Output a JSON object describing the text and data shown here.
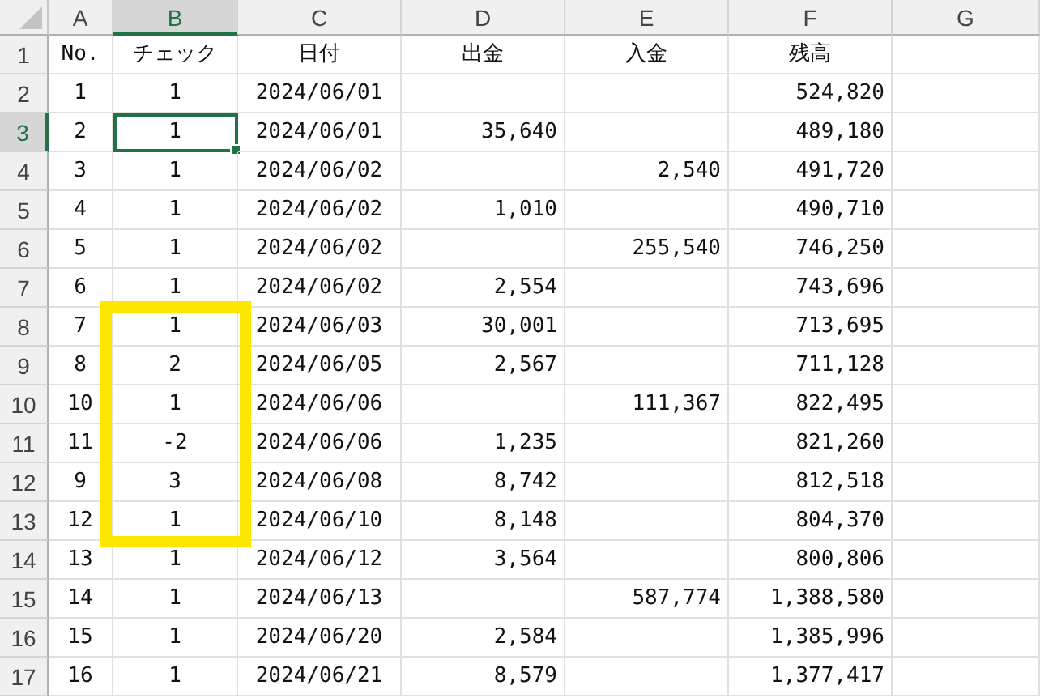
{
  "columns": [
    {
      "label": "A",
      "selected": false
    },
    {
      "label": "B",
      "selected": true
    },
    {
      "label": "C",
      "selected": false
    },
    {
      "label": "D",
      "selected": false
    },
    {
      "label": "E",
      "selected": false
    },
    {
      "label": "F",
      "selected": false
    },
    {
      "label": "G",
      "selected": false
    }
  ],
  "rows": [
    {
      "label": "1",
      "selected": false,
      "boxed": false,
      "cells": [
        "No.",
        "チェック",
        "日付",
        "出金",
        "入金",
        "残高",
        ""
      ]
    },
    {
      "label": "2",
      "selected": false,
      "boxed": false,
      "cells": [
        "1",
        "1",
        "2024/06/01",
        "",
        "",
        "524,820",
        ""
      ]
    },
    {
      "label": "3",
      "selected": true,
      "boxed": false,
      "cells": [
        "2",
        "1",
        "2024/06/01",
        "35,640",
        "",
        "489,180",
        ""
      ]
    },
    {
      "label": "4",
      "selected": false,
      "boxed": false,
      "cells": [
        "3",
        "1",
        "2024/06/02",
        "",
        "2,540",
        "491,720",
        ""
      ]
    },
    {
      "label": "5",
      "selected": false,
      "boxed": false,
      "cells": [
        "4",
        "1",
        "2024/06/02",
        "1,010",
        "",
        "490,710",
        ""
      ]
    },
    {
      "label": "6",
      "selected": false,
      "boxed": false,
      "cells": [
        "5",
        "1",
        "2024/06/02",
        "",
        "255,540",
        "746,250",
        ""
      ]
    },
    {
      "label": "7",
      "selected": false,
      "boxed": false,
      "cells": [
        "6",
        "1",
        "2024/06/02",
        "2,554",
        "",
        "743,696",
        ""
      ]
    },
    {
      "label": "8",
      "selected": false,
      "boxed": true,
      "cells": [
        "7",
        "1",
        "2024/06/03",
        "30,001",
        "",
        "713,695",
        ""
      ]
    },
    {
      "label": "9",
      "selected": false,
      "boxed": true,
      "cells": [
        "8",
        "2",
        "2024/06/05",
        "2,567",
        "",
        "711,128",
        ""
      ]
    },
    {
      "label": "10",
      "selected": false,
      "boxed": true,
      "cells": [
        "10",
        "1",
        "2024/06/06",
        "",
        "111,367",
        "822,495",
        ""
      ]
    },
    {
      "label": "11",
      "selected": false,
      "boxed": true,
      "cells": [
        "11",
        "-2",
        "2024/06/06",
        "1,235",
        "",
        "821,260",
        ""
      ]
    },
    {
      "label": "12",
      "selected": false,
      "boxed": true,
      "cells": [
        "9",
        "3",
        "2024/06/08",
        "8,742",
        "",
        "812,518",
        ""
      ]
    },
    {
      "label": "13",
      "selected": false,
      "boxed": true,
      "cells": [
        "12",
        "1",
        "2024/06/10",
        "8,148",
        "",
        "804,370",
        ""
      ]
    },
    {
      "label": "14",
      "selected": false,
      "boxed": false,
      "cells": [
        "13",
        "1",
        "2024/06/12",
        "3,564",
        "",
        "800,806",
        ""
      ]
    },
    {
      "label": "15",
      "selected": false,
      "boxed": false,
      "cells": [
        "14",
        "1",
        "2024/06/13",
        "",
        "587,774",
        "1,388,580",
        ""
      ]
    },
    {
      "label": "16",
      "selected": false,
      "boxed": false,
      "cells": [
        "15",
        "1",
        "2024/06/20",
        "2,584",
        "",
        "1,385,996",
        ""
      ]
    },
    {
      "label": "17",
      "selected": false,
      "boxed": false,
      "cells": [
        "16",
        "1",
        "2024/06/21",
        "8,579",
        "",
        "1,377,417",
        ""
      ]
    }
  ]
}
